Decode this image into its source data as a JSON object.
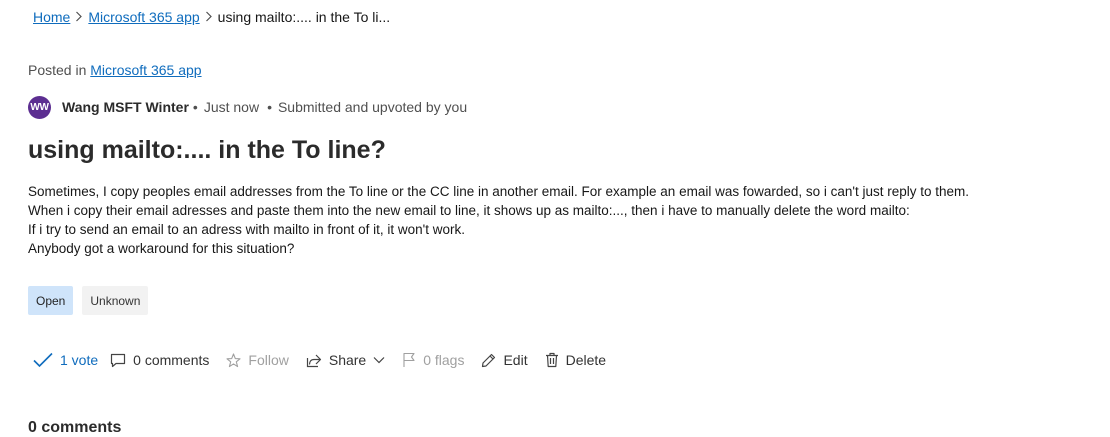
{
  "breadcrumb": {
    "home": "Home",
    "category": "Microsoft 365 app",
    "current": "using mailto:.... in the To li..."
  },
  "posted_in": {
    "label": "Posted in",
    "link": "Microsoft 365 app"
  },
  "meta": {
    "avatar_initials": "WW",
    "author": "Wang MSFT Winter",
    "time": "Just now",
    "status": "Submitted and upvoted by you",
    "avatar_color": "#5c2e91"
  },
  "post": {
    "title": "using mailto:.... in the To line?",
    "body": [
      "Sometimes, I copy peoples email addresses from the To line or the CC line in another email. For example an email was fowarded, so i can't just reply to them.",
      "When i copy their email adresses and paste them into the new email to line, it shows up as mailto:..., then i have to manually delete the word mailto:",
      "If i try to send an email to an adress with mailto in front of it, it won't work.",
      "Anybody got a workaround for this situation?"
    ]
  },
  "tags": {
    "status": "Open",
    "type": "Unknown"
  },
  "actions": {
    "vote": "1 vote",
    "comments": "0 comments",
    "follow": "Follow",
    "share": "Share",
    "flags": "0 flags",
    "edit": "Edit",
    "delete": "Delete"
  },
  "comments_section": {
    "heading": "0 comments"
  },
  "colors": {
    "link": "#0f6cbd",
    "tag_open_bg": "#cfe4fa",
    "tag_unknown_bg": "#f2f2f2"
  }
}
